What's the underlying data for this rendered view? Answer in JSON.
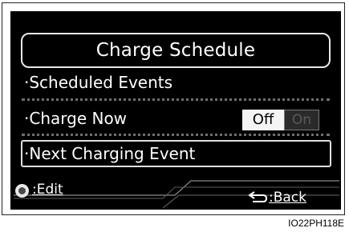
{
  "screen": {
    "title": "Charge Schedule",
    "items": [
      {
        "label": "·Scheduled Events"
      },
      {
        "label": "·Charge Now",
        "toggle": {
          "off_label": "Off",
          "on_label": "On",
          "selected": "Off"
        }
      },
      {
        "label": "·Next Charging Event"
      }
    ],
    "footer": {
      "edit_label": ":Edit",
      "back_label": ":Back",
      "edit_icon": "control-knob-icon",
      "back_icon": "return-arrow-icon"
    }
  },
  "figure_code": "IO22PH118E",
  "colors": {
    "screen_background": "#000000",
    "text": "#ffffff",
    "toggle_off_bg": "#f4f4f4",
    "toggle_on_text": "#5a5a5a"
  }
}
